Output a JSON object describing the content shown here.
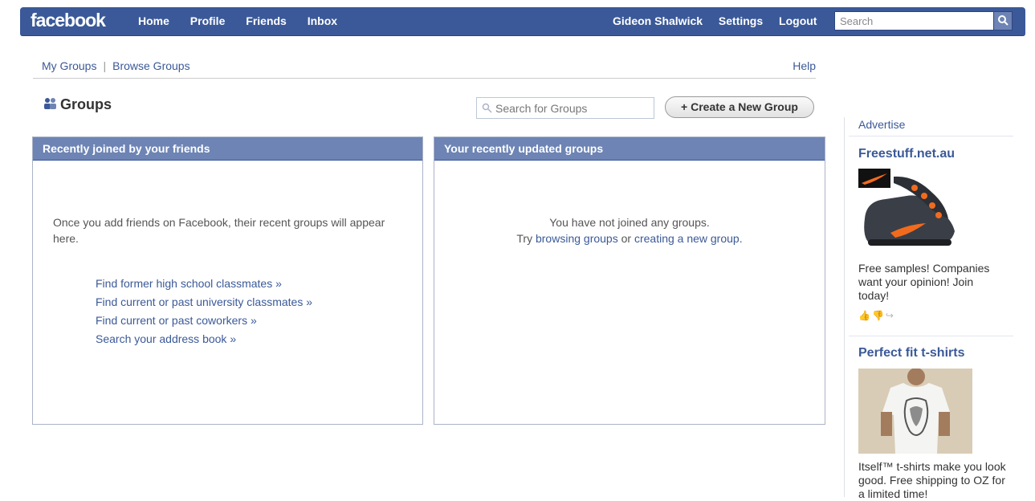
{
  "topbar": {
    "logo": "facebook",
    "nav_left": [
      "Home",
      "Profile",
      "Friends",
      "Inbox"
    ],
    "nav_right": [
      "Gideon Shalwick",
      "Settings",
      "Logout"
    ],
    "search_placeholder": "Search",
    "bg_color": "#3b5998"
  },
  "subnav": {
    "my_groups": "My Groups",
    "separator": "|",
    "browse_groups": "Browse Groups",
    "help": "Help"
  },
  "header": {
    "title": "Groups",
    "search_placeholder": "Search for Groups",
    "create_button": "+ Create a New Group"
  },
  "left_panel": {
    "heading": "Recently joined by your friends",
    "message": "Once you add friends on Facebook, their recent groups will appear here.",
    "links": [
      "Find former high school classmates »",
      "Find current or past university classmates »",
      "Find current or past coworkers »",
      "Search your address book »"
    ]
  },
  "right_panel": {
    "heading": "Your recently updated groups",
    "line1": "You have not joined any groups.",
    "line2_prefix": "Try",
    "link1": "browsing groups",
    "line2_mid": "or",
    "link2": "creating a new group",
    "line2_suffix": "."
  },
  "sidebar": {
    "advertise": "Advertise",
    "ads": [
      {
        "title": "Freestuff.net.au",
        "text": "Free samples! Companies want your opinion! Join today!",
        "image": "sneaker-image"
      },
      {
        "title": "Perfect fit t-shirts",
        "text": "Itself™ t-shirts make you look good. Free shipping to OZ for a limited time!",
        "image": "tshirt-image"
      }
    ]
  }
}
